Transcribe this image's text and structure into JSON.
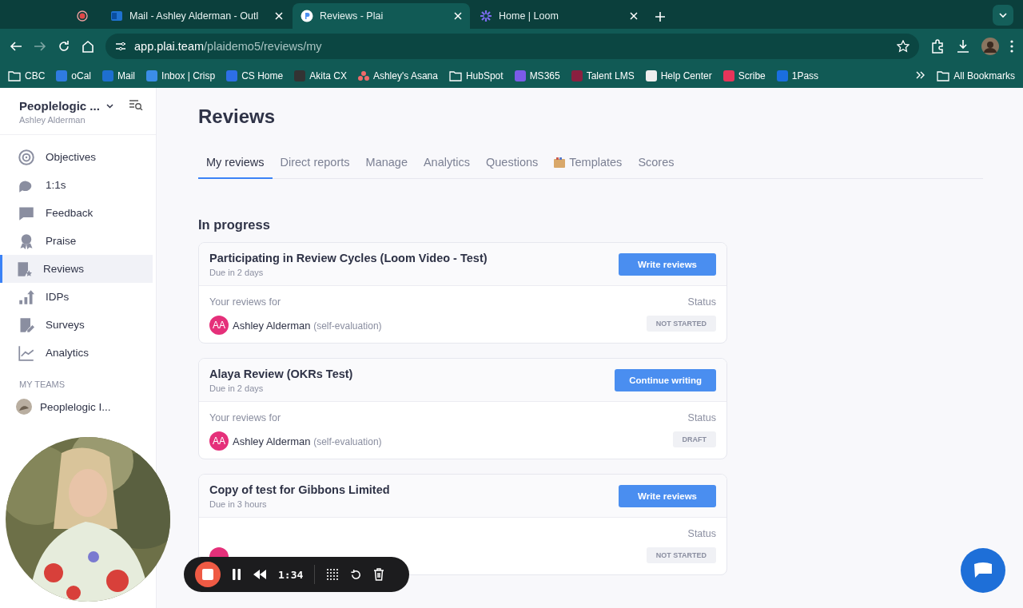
{
  "browser": {
    "tabs": [
      {
        "kind": "recording",
        "selected": false
      },
      {
        "kind": "mail",
        "title": "Mail - Ashley Alderman - Outl",
        "selected": false
      },
      {
        "kind": "plai",
        "title": "Reviews - Plai",
        "selected": true
      },
      {
        "kind": "loom",
        "title": "Home | Loom",
        "selected": false
      }
    ],
    "address": {
      "host": "app.plai.team",
      "path": "/plaidemo5/reviews/my"
    },
    "bookmarks": [
      {
        "kind": "folder",
        "label": "CBC"
      },
      {
        "kind": "app",
        "label": "oCal",
        "color": "#2f7be0"
      },
      {
        "kind": "app",
        "label": "Mail",
        "color": "#1e6fd0"
      },
      {
        "kind": "app",
        "label": "Inbox | Crisp",
        "color": "#3b8de8"
      },
      {
        "kind": "app",
        "label": "CS Home",
        "color": "#2d6fe6"
      },
      {
        "kind": "app",
        "label": "Akita CX",
        "color": "#333333"
      },
      {
        "kind": "dots",
        "label": "Ashley's Asana",
        "color": "#f06a6a"
      },
      {
        "kind": "folder",
        "label": "HubSpot"
      },
      {
        "kind": "app",
        "label": "MS365",
        "color": "#7b5be8"
      },
      {
        "kind": "app",
        "label": "Talent LMS",
        "color": "#8a2040"
      },
      {
        "kind": "app",
        "label": "Help Center",
        "color": "#eeeeee"
      },
      {
        "kind": "app",
        "label": "Scribe",
        "color": "#e8345a"
      },
      {
        "kind": "app",
        "label": "1Pass",
        "color": "#1a6ee0"
      }
    ],
    "all_bookmarks": "All Bookmarks"
  },
  "sidebar": {
    "org": "Peoplelogic ...",
    "user": "Ashley Alderman",
    "items": [
      {
        "label": "Objectives",
        "selected": false
      },
      {
        "label": "1:1s",
        "selected": false
      },
      {
        "label": "Feedback",
        "selected": false
      },
      {
        "label": "Praise",
        "selected": false
      },
      {
        "label": "Reviews",
        "selected": true
      },
      {
        "label": "IDPs",
        "selected": false
      },
      {
        "label": "Surveys",
        "selected": false
      },
      {
        "label": "Analytics",
        "selected": false
      }
    ],
    "section": "MY TEAMS",
    "team": "Peoplelogic I..."
  },
  "page": {
    "title": "Reviews",
    "tabs": [
      {
        "kind": "plain",
        "label": "My reviews",
        "selected": true
      },
      {
        "kind": "plain",
        "label": "Direct reports",
        "selected": false
      },
      {
        "kind": "plain",
        "label": "Manage",
        "selected": false
      },
      {
        "kind": "plain",
        "label": "Analytics",
        "selected": false
      },
      {
        "kind": "plain",
        "label": "Questions",
        "selected": false
      },
      {
        "kind": "icon",
        "label": "Templates",
        "selected": false
      },
      {
        "kind": "plain",
        "label": "Scores",
        "selected": false
      }
    ],
    "section": "In progress",
    "cards": [
      {
        "title": "Participating in Review Cycles (Loom Video - Test)",
        "due": "Due in 2 days",
        "action": "Write reviews",
        "reviews_for": "Your reviews for",
        "status_label": "Status",
        "reviewee": {
          "initials": "AA",
          "name": "Ashley Alderman",
          "note": "(self-evaluation)"
        },
        "status": "NOT STARTED"
      },
      {
        "title": "Alaya Review (OKRs Test)",
        "due": "Due in 2 days",
        "action": "Continue writing",
        "reviews_for": "Your reviews for",
        "status_label": "Status",
        "reviewee": {
          "initials": "AA",
          "name": "Ashley Alderman",
          "note": "(self-evaluation)"
        },
        "status": "DRAFT"
      },
      {
        "title": "Copy of test for Gibbons Limited",
        "due": "Due in 3 hours",
        "action": "Write reviews",
        "status_label": "Status",
        "status": "NOT STARTED"
      }
    ]
  },
  "recorder": {
    "time": "1:34"
  }
}
